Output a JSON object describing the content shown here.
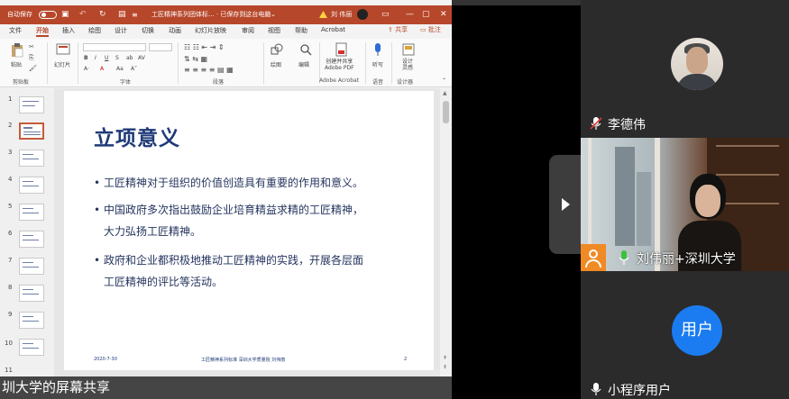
{
  "ppt": {
    "titlebar": {
      "autosave_label": "自动保存",
      "autosave_state": "关",
      "doc_title": "工匠精神系列团体标... · 已保存到这台电脑",
      "user_name": "刘 伟丽"
    },
    "menu": [
      "文件",
      "开始",
      "插入",
      "绘图",
      "设计",
      "切换",
      "动画",
      "幻灯片放映",
      "审阅",
      "视图",
      "帮助",
      "Acrobat"
    ],
    "active_menu": "开始",
    "share_label": "共享",
    "comment_label": "批注",
    "ribbon": {
      "paste": "粘贴",
      "clipboard": "剪贴板",
      "new_slide": "幻灯片",
      "font": "字体",
      "paragraph": "段落",
      "find": "绘图",
      "edit": "编辑",
      "acrobat_btn": "创建并共享\nAdobe PDF",
      "acrobat_group": "Adobe Acrobat",
      "dictate": "听写",
      "voice": "语音",
      "designer": "设计\n灵感",
      "designer_group": "设计器"
    },
    "thumb_numbers": [
      "1",
      "2",
      "3",
      "4",
      "5",
      "6",
      "7",
      "8",
      "9",
      "10",
      "11"
    ],
    "slide": {
      "title": "立项意义",
      "bullets": [
        {
          "line1": "工匠精神对于组织的价值创造具有重要的作用和意义。",
          "line2": ""
        },
        {
          "line1": "中国政府多次指出鼓励企业培育精益求精的工匠精神，",
          "line2": "大力弘扬工匠精神。"
        },
        {
          "line1": "政府和企业都积极地推动工匠精神的实践，开展各层面",
          "line2": "工匠精神的评比等活动。"
        }
      ],
      "footer_date": "2020-7-30",
      "footer_center": "工匠精神系列标准  深圳大学质量院 刘伟丽",
      "page_number": "2"
    },
    "screen_share_caption": "圳大学的屏幕共享"
  },
  "participants": [
    {
      "name": "李德伟",
      "muted": true
    },
    {
      "name": "刘伟丽+深圳大学",
      "muted": false
    },
    {
      "name": "小程序用户",
      "avatar_text": "用户",
      "muted": true
    }
  ],
  "colors": {
    "ppt_accent": "#b7472a",
    "slide_title": "#1f3a78",
    "user_avatar": "#1a7cf0",
    "video_icon": "#f08a24"
  }
}
